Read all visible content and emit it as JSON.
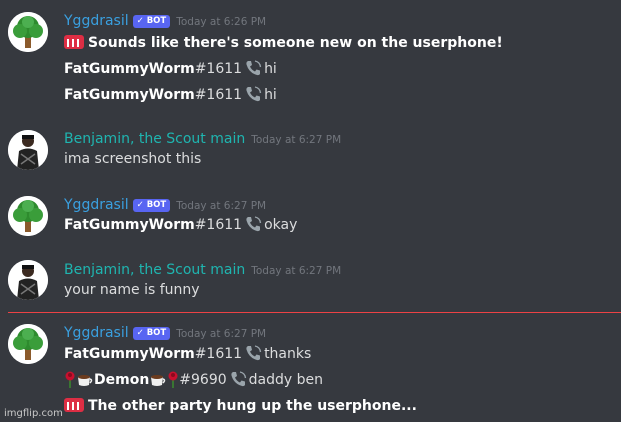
{
  "messages": [
    {
      "author": "Yggdrasil",
      "bot_tag": "✓ BOT",
      "timestamp": "Today at 6:26 PM",
      "lines": [
        {
          "kind": "system",
          "text": "Sounds like there's someone new on the userphone!"
        },
        {
          "kind": "relay",
          "name": "FatGummyWorm",
          "tag": "#1611",
          "text": "hi"
        },
        {
          "kind": "relay",
          "name": "FatGummyWorm",
          "tag": "#1611",
          "text": "hi"
        }
      ]
    },
    {
      "author": "Benjamin, the Scout main",
      "timestamp": "Today at 6:27 PM",
      "lines": [
        {
          "kind": "plain",
          "text": "ima screenshot this"
        }
      ]
    },
    {
      "author": "Yggdrasil",
      "bot_tag": "✓ BOT",
      "timestamp": "Today at 6:27 PM",
      "lines": [
        {
          "kind": "relay",
          "name": "FatGummyWorm",
          "tag": "#1611",
          "text": "okay"
        }
      ]
    },
    {
      "author": "Benjamin, the Scout main",
      "timestamp": "Today at 6:27 PM",
      "lines": [
        {
          "kind": "plain",
          "text": "your name is funny"
        }
      ]
    },
    {
      "author": "Yggdrasil",
      "bot_tag": "✓ BOT",
      "timestamp": "Today at 6:27 PM",
      "lines": [
        {
          "kind": "relay",
          "name": "FatGummyWorm",
          "tag": "#1611",
          "text": "thanks"
        },
        {
          "kind": "relay",
          "name": "Demon",
          "tag": "#9690",
          "text": "daddy ben"
        },
        {
          "kind": "system",
          "text": "The other party hung up the userphone..."
        }
      ]
    }
  ],
  "watermark": "imgflip.com",
  "colors": {
    "background": "#36393f",
    "bot_name": "#3aa0e0",
    "user_name": "#1fb5b0",
    "new_divider": "#ed4245"
  }
}
